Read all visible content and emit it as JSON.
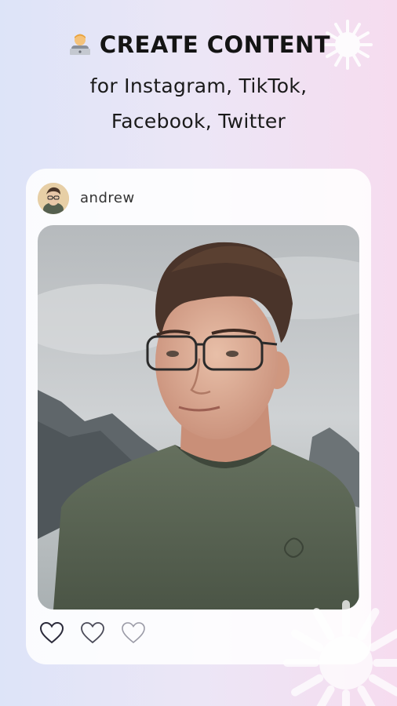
{
  "headline": {
    "emoji_icon": "technologist-emoji-icon",
    "title": "CREATE CONTENT",
    "subtitle_line1": "for Instagram, TikTok,",
    "subtitle_line2": "Facebook, Twitter"
  },
  "post": {
    "username": "andrew",
    "avatar_icon": "profile-avatar",
    "photo_icon": "portrait-photo",
    "actions": [
      {
        "icon": "heart-outline-icon",
        "color": "#2a2a3a"
      },
      {
        "icon": "heart-outline-icon",
        "color": "#4a4a58"
      },
      {
        "icon": "heart-outline-icon",
        "color": "#9a9aa6"
      }
    ]
  },
  "colors": {
    "background_left": "#dde4f8",
    "background_right": "#f6dcef",
    "card": "#ffffff",
    "text": "#141414"
  }
}
